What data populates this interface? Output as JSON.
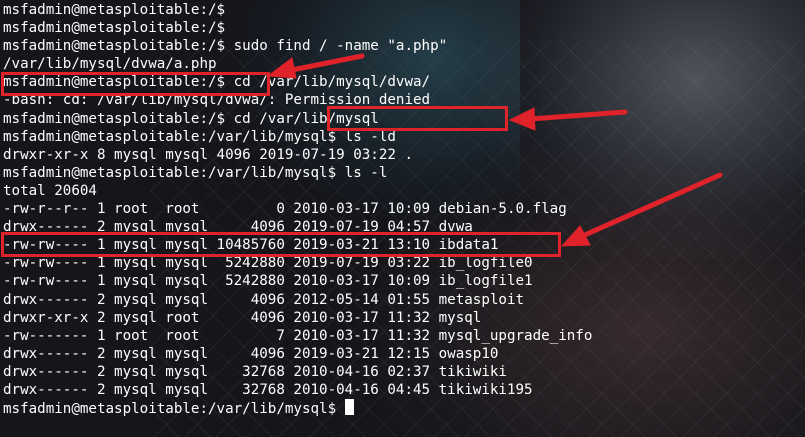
{
  "terminal": {
    "lines": [
      "msfadmin@metasploitable:/$",
      "msfadmin@metasploitable:/$",
      "msfadmin@metasploitable:/$ sudo find / -name \"a.php\"",
      "/var/lib/mysql/dvwa/a.php",
      "msfadmin@metasploitable:/$ cd /var/lib/mysql/dvwa/",
      "-bash: cd: /var/lib/mysql/dvwa/: Permission denied",
      "msfadmin@metasploitable:/$ cd /var/lib/mysql",
      "msfadmin@metasploitable:/var/lib/mysql$ ls -ld",
      "drwxr-xr-x 8 mysql mysql 4096 2019-07-19 03:22 .",
      "msfadmin@metasploitable:/var/lib/mysql$ ls -l",
      "total 20604",
      "-rw-r--r-- 1 root  root         0 2010-03-17 10:09 debian-5.0.flag",
      "drwx------ 2 mysql mysql     4096 2019-07-19 04:57 dvwa",
      "-rw-rw---- 1 mysql mysql 10485760 2019-03-21 13:10 ibdata1",
      "-rw-rw---- 1 mysql mysql  5242880 2019-07-19 03:22 ib_logfile0",
      "-rw-rw---- 1 mysql mysql  5242880 2010-03-17 10:09 ib_logfile1",
      "drwx------ 2 mysql mysql     4096 2012-05-14 01:55 metasploit",
      "drwxr-xr-x 2 mysql root      4096 2010-03-17 11:32 mysql",
      "-rw------- 1 root  root         7 2010-03-17 11:32 mysql_upgrade_info",
      "drwx------ 2 mysql mysql     4096 2019-03-21 12:15 owasp10",
      "drwx------ 2 mysql mysql    32768 2010-04-16 02:37 tikiwiki",
      "drwx------ 2 mysql mysql    32768 2010-04-16 04:45 tikiwiki195"
    ],
    "prompt": "msfadmin@metasploitable:/var/lib/mysql$ "
  },
  "annotations": {
    "color": "#e0222a"
  }
}
